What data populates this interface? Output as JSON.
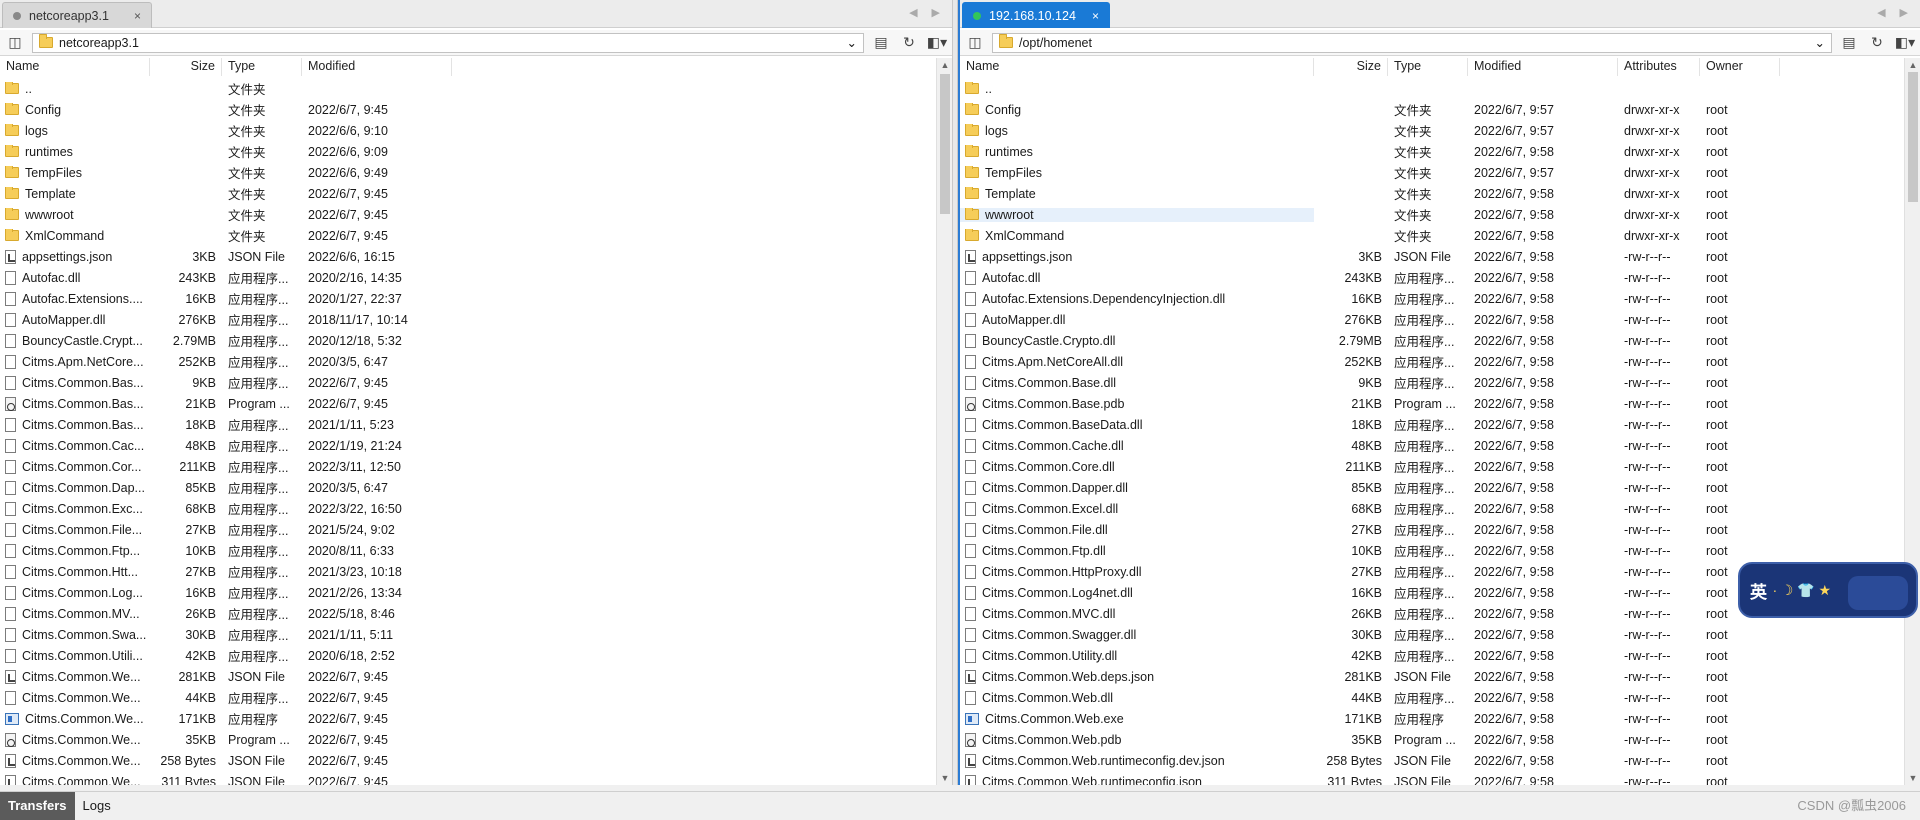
{
  "left": {
    "tab_label": "netcoreapp3.1",
    "tab_close": "×",
    "path": "netcoreapp3.1",
    "columns": [
      "Name",
      "Size",
      "Type",
      "Modified"
    ],
    "rows": [
      {
        "icon": "folder",
        "name": "..",
        "size": "",
        "type": "文件夹",
        "modified": ""
      },
      {
        "icon": "folder",
        "name": "Config",
        "size": "",
        "type": "文件夹",
        "modified": "2022/6/7, 9:45"
      },
      {
        "icon": "folder",
        "name": "logs",
        "size": "",
        "type": "文件夹",
        "modified": "2022/6/6, 9:10"
      },
      {
        "icon": "folder",
        "name": "runtimes",
        "size": "",
        "type": "文件夹",
        "modified": "2022/6/6, 9:09"
      },
      {
        "icon": "folder",
        "name": "TempFiles",
        "size": "",
        "type": "文件夹",
        "modified": "2022/6/6, 9:49"
      },
      {
        "icon": "folder",
        "name": "Template",
        "size": "",
        "type": "文件夹",
        "modified": "2022/6/7, 9:45"
      },
      {
        "icon": "folder",
        "name": "wwwroot",
        "size": "",
        "type": "文件夹",
        "modified": "2022/6/7, 9:45"
      },
      {
        "icon": "folder",
        "name": "XmlCommand",
        "size": "",
        "type": "文件夹",
        "modified": "2022/6/7, 9:45"
      },
      {
        "icon": "json",
        "name": "appsettings.json",
        "size": "3KB",
        "type": "JSON File",
        "modified": "2022/6/6, 16:15"
      },
      {
        "icon": "dll",
        "name": "Autofac.dll",
        "size": "243KB",
        "type": "应用程序...",
        "modified": "2020/2/16, 14:35"
      },
      {
        "icon": "dll",
        "name": "Autofac.Extensions....",
        "size": "16KB",
        "type": "应用程序...",
        "modified": "2020/1/27, 22:37"
      },
      {
        "icon": "dll",
        "name": "AutoMapper.dll",
        "size": "276KB",
        "type": "应用程序...",
        "modified": "2018/11/17, 10:14"
      },
      {
        "icon": "dll",
        "name": "BouncyCastle.Crypt...",
        "size": "2.79MB",
        "type": "应用程序...",
        "modified": "2020/12/18, 5:32"
      },
      {
        "icon": "dll",
        "name": "Citms.Apm.NetCore...",
        "size": "252KB",
        "type": "应用程序...",
        "modified": "2020/3/5, 6:47"
      },
      {
        "icon": "dll",
        "name": "Citms.Common.Bas...",
        "size": "9KB",
        "type": "应用程序...",
        "modified": "2022/6/7, 9:45"
      },
      {
        "icon": "pdb",
        "name": "Citms.Common.Bas...",
        "size": "21KB",
        "type": "Program ...",
        "modified": "2022/6/7, 9:45"
      },
      {
        "icon": "dll",
        "name": "Citms.Common.Bas...",
        "size": "18KB",
        "type": "应用程序...",
        "modified": "2021/1/11, 5:23"
      },
      {
        "icon": "dll",
        "name": "Citms.Common.Cac...",
        "size": "48KB",
        "type": "应用程序...",
        "modified": "2022/1/19, 21:24"
      },
      {
        "icon": "dll",
        "name": "Citms.Common.Cor...",
        "size": "211KB",
        "type": "应用程序...",
        "modified": "2022/3/11, 12:50"
      },
      {
        "icon": "dll",
        "name": "Citms.Common.Dap...",
        "size": "85KB",
        "type": "应用程序...",
        "modified": "2020/3/5, 6:47"
      },
      {
        "icon": "dll",
        "name": "Citms.Common.Exc...",
        "size": "68KB",
        "type": "应用程序...",
        "modified": "2022/3/22, 16:50"
      },
      {
        "icon": "dll",
        "name": "Citms.Common.File...",
        "size": "27KB",
        "type": "应用程序...",
        "modified": "2021/5/24, 9:02"
      },
      {
        "icon": "dll",
        "name": "Citms.Common.Ftp...",
        "size": "10KB",
        "type": "应用程序...",
        "modified": "2020/8/11, 6:33"
      },
      {
        "icon": "dll",
        "name": "Citms.Common.Htt...",
        "size": "27KB",
        "type": "应用程序...",
        "modified": "2021/3/23, 10:18"
      },
      {
        "icon": "dll",
        "name": "Citms.Common.Log...",
        "size": "16KB",
        "type": "应用程序...",
        "modified": "2021/2/26, 13:34"
      },
      {
        "icon": "dll",
        "name": "Citms.Common.MV...",
        "size": "26KB",
        "type": "应用程序...",
        "modified": "2022/5/18, 8:46"
      },
      {
        "icon": "dll",
        "name": "Citms.Common.Swa...",
        "size": "30KB",
        "type": "应用程序...",
        "modified": "2021/1/11, 5:11"
      },
      {
        "icon": "dll",
        "name": "Citms.Common.Utili...",
        "size": "42KB",
        "type": "应用程序...",
        "modified": "2020/6/18, 2:52"
      },
      {
        "icon": "json",
        "name": "Citms.Common.We...",
        "size": "281KB",
        "type": "JSON File",
        "modified": "2022/6/7, 9:45"
      },
      {
        "icon": "dll",
        "name": "Citms.Common.We...",
        "size": "44KB",
        "type": "应用程序...",
        "modified": "2022/6/7, 9:45"
      },
      {
        "icon": "exe",
        "name": "Citms.Common.We...",
        "size": "171KB",
        "type": "应用程序",
        "modified": "2022/6/7, 9:45"
      },
      {
        "icon": "pdb",
        "name": "Citms.Common.We...",
        "size": "35KB",
        "type": "Program ...",
        "modified": "2022/6/7, 9:45"
      },
      {
        "icon": "json",
        "name": "Citms.Common.We...",
        "size": "258 Bytes",
        "type": "JSON File",
        "modified": "2022/6/7, 9:45"
      },
      {
        "icon": "json",
        "name": "Citms.Common.We...",
        "size": "311 Bytes",
        "type": "JSON File",
        "modified": "2022/6/7, 9:45"
      }
    ]
  },
  "right": {
    "tab_label": "192.168.10.124",
    "tab_close": "×",
    "path": "/opt/homenet",
    "columns": [
      "Name",
      "Size",
      "Type",
      "Modified",
      "Attributes",
      "Owner"
    ],
    "rows": [
      {
        "icon": "folder",
        "name": "..",
        "size": "",
        "type": "",
        "modified": "",
        "attributes": "",
        "owner": ""
      },
      {
        "icon": "folder",
        "name": "Config",
        "size": "",
        "type": "文件夹",
        "modified": "2022/6/7, 9:57",
        "attributes": "drwxr-xr-x",
        "owner": "root"
      },
      {
        "icon": "folder",
        "name": "logs",
        "size": "",
        "type": "文件夹",
        "modified": "2022/6/7, 9:57",
        "attributes": "drwxr-xr-x",
        "owner": "root"
      },
      {
        "icon": "folder",
        "name": "runtimes",
        "size": "",
        "type": "文件夹",
        "modified": "2022/6/7, 9:58",
        "attributes": "drwxr-xr-x",
        "owner": "root"
      },
      {
        "icon": "folder",
        "name": "TempFiles",
        "size": "",
        "type": "文件夹",
        "modified": "2022/6/7, 9:57",
        "attributes": "drwxr-xr-x",
        "owner": "root"
      },
      {
        "icon": "folder",
        "name": "Template",
        "size": "",
        "type": "文件夹",
        "modified": "2022/6/7, 9:58",
        "attributes": "drwxr-xr-x",
        "owner": "root"
      },
      {
        "icon": "folder",
        "name": "wwwroot",
        "size": "",
        "type": "文件夹",
        "modified": "2022/6/7, 9:58",
        "attributes": "drwxr-xr-x",
        "owner": "root",
        "selected": true
      },
      {
        "icon": "folder",
        "name": "XmlCommand",
        "size": "",
        "type": "文件夹",
        "modified": "2022/6/7, 9:58",
        "attributes": "drwxr-xr-x",
        "owner": "root"
      },
      {
        "icon": "json",
        "name": "appsettings.json",
        "size": "3KB",
        "type": "JSON File",
        "modified": "2022/6/7, 9:58",
        "attributes": "-rw-r--r--",
        "owner": "root"
      },
      {
        "icon": "dll",
        "name": "Autofac.dll",
        "size": "243KB",
        "type": "应用程序...",
        "modified": "2022/6/7, 9:58",
        "attributes": "-rw-r--r--",
        "owner": "root"
      },
      {
        "icon": "dll",
        "name": "Autofac.Extensions.DependencyInjection.dll",
        "size": "16KB",
        "type": "应用程序...",
        "modified": "2022/6/7, 9:58",
        "attributes": "-rw-r--r--",
        "owner": "root"
      },
      {
        "icon": "dll",
        "name": "AutoMapper.dll",
        "size": "276KB",
        "type": "应用程序...",
        "modified": "2022/6/7, 9:58",
        "attributes": "-rw-r--r--",
        "owner": "root"
      },
      {
        "icon": "dll",
        "name": "BouncyCastle.Crypto.dll",
        "size": "2.79MB",
        "type": "应用程序...",
        "modified": "2022/6/7, 9:58",
        "attributes": "-rw-r--r--",
        "owner": "root"
      },
      {
        "icon": "dll",
        "name": "Citms.Apm.NetCoreAll.dll",
        "size": "252KB",
        "type": "应用程序...",
        "modified": "2022/6/7, 9:58",
        "attributes": "-rw-r--r--",
        "owner": "root"
      },
      {
        "icon": "dll",
        "name": "Citms.Common.Base.dll",
        "size": "9KB",
        "type": "应用程序...",
        "modified": "2022/6/7, 9:58",
        "attributes": "-rw-r--r--",
        "owner": "root"
      },
      {
        "icon": "pdb",
        "name": "Citms.Common.Base.pdb",
        "size": "21KB",
        "type": "Program ...",
        "modified": "2022/6/7, 9:58",
        "attributes": "-rw-r--r--",
        "owner": "root"
      },
      {
        "icon": "dll",
        "name": "Citms.Common.BaseData.dll",
        "size": "18KB",
        "type": "应用程序...",
        "modified": "2022/6/7, 9:58",
        "attributes": "-rw-r--r--",
        "owner": "root"
      },
      {
        "icon": "dll",
        "name": "Citms.Common.Cache.dll",
        "size": "48KB",
        "type": "应用程序...",
        "modified": "2022/6/7, 9:58",
        "attributes": "-rw-r--r--",
        "owner": "root"
      },
      {
        "icon": "dll",
        "name": "Citms.Common.Core.dll",
        "size": "211KB",
        "type": "应用程序...",
        "modified": "2022/6/7, 9:58",
        "attributes": "-rw-r--r--",
        "owner": "root"
      },
      {
        "icon": "dll",
        "name": "Citms.Common.Dapper.dll",
        "size": "85KB",
        "type": "应用程序...",
        "modified": "2022/6/7, 9:58",
        "attributes": "-rw-r--r--",
        "owner": "root"
      },
      {
        "icon": "dll",
        "name": "Citms.Common.Excel.dll",
        "size": "68KB",
        "type": "应用程序...",
        "modified": "2022/6/7, 9:58",
        "attributes": "-rw-r--r--",
        "owner": "root"
      },
      {
        "icon": "dll",
        "name": "Citms.Common.File.dll",
        "size": "27KB",
        "type": "应用程序...",
        "modified": "2022/6/7, 9:58",
        "attributes": "-rw-r--r--",
        "owner": "root"
      },
      {
        "icon": "dll",
        "name": "Citms.Common.Ftp.dll",
        "size": "10KB",
        "type": "应用程序...",
        "modified": "2022/6/7, 9:58",
        "attributes": "-rw-r--r--",
        "owner": "root"
      },
      {
        "icon": "dll",
        "name": "Citms.Common.HttpProxy.dll",
        "size": "27KB",
        "type": "应用程序...",
        "modified": "2022/6/7, 9:58",
        "attributes": "-rw-r--r--",
        "owner": "root"
      },
      {
        "icon": "dll",
        "name": "Citms.Common.Log4net.dll",
        "size": "16KB",
        "type": "应用程序...",
        "modified": "2022/6/7, 9:58",
        "attributes": "-rw-r--r--",
        "owner": "root"
      },
      {
        "icon": "dll",
        "name": "Citms.Common.MVC.dll",
        "size": "26KB",
        "type": "应用程序...",
        "modified": "2022/6/7, 9:58",
        "attributes": "-rw-r--r--",
        "owner": "root"
      },
      {
        "icon": "dll",
        "name": "Citms.Common.Swagger.dll",
        "size": "30KB",
        "type": "应用程序...",
        "modified": "2022/6/7, 9:58",
        "attributes": "-rw-r--r--",
        "owner": "root"
      },
      {
        "icon": "dll",
        "name": "Citms.Common.Utility.dll",
        "size": "42KB",
        "type": "应用程序...",
        "modified": "2022/6/7, 9:58",
        "attributes": "-rw-r--r--",
        "owner": "root"
      },
      {
        "icon": "json",
        "name": "Citms.Common.Web.deps.json",
        "size": "281KB",
        "type": "JSON File",
        "modified": "2022/6/7, 9:58",
        "attributes": "-rw-r--r--",
        "owner": "root"
      },
      {
        "icon": "dll",
        "name": "Citms.Common.Web.dll",
        "size": "44KB",
        "type": "应用程序...",
        "modified": "2022/6/7, 9:58",
        "attributes": "-rw-r--r--",
        "owner": "root"
      },
      {
        "icon": "exe",
        "name": "Citms.Common.Web.exe",
        "size": "171KB",
        "type": "应用程序",
        "modified": "2022/6/7, 9:58",
        "attributes": "-rw-r--r--",
        "owner": "root"
      },
      {
        "icon": "pdb",
        "name": "Citms.Common.Web.pdb",
        "size": "35KB",
        "type": "Program ...",
        "modified": "2022/6/7, 9:58",
        "attributes": "-rw-r--r--",
        "owner": "root"
      },
      {
        "icon": "json",
        "name": "Citms.Common.Web.runtimeconfig.dev.json",
        "size": "258 Bytes",
        "type": "JSON File",
        "modified": "2022/6/7, 9:58",
        "attributes": "-rw-r--r--",
        "owner": "root"
      },
      {
        "icon": "json",
        "name": "Citms.Common.Web.runtimeconfig.json",
        "size": "311 Bytes",
        "type": "JSON File",
        "modified": "2022/6/7, 9:58",
        "attributes": "-rw-r--r--",
        "owner": "root"
      }
    ]
  },
  "bottom": {
    "tabs": [
      "Transfers",
      "Logs"
    ],
    "watermark": "CSDN @瓢虫2006"
  },
  "ime": {
    "label": "英",
    "glyphs": "∙ ☽ 👕 ★"
  },
  "colors": {
    "accent": "#1a7ad6",
    "folder": "#f6cd59",
    "connected": "#33c65a"
  }
}
